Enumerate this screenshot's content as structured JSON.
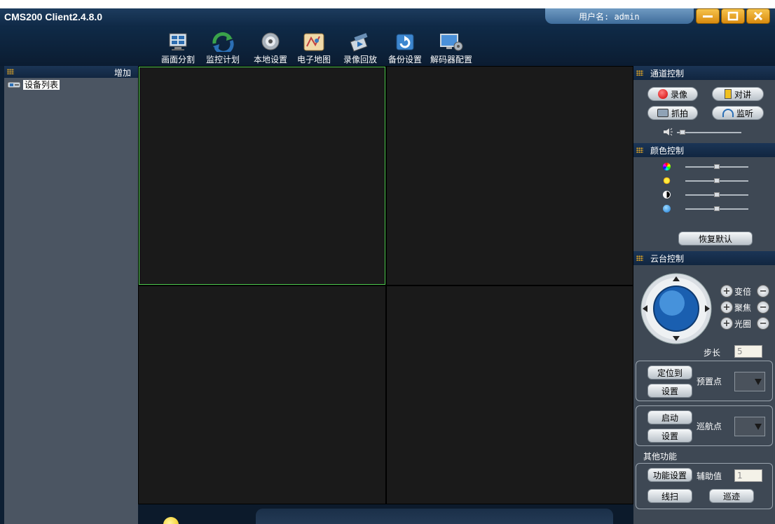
{
  "window": {
    "title": "CMS200 Client2.4.8.0",
    "user_label": "用户名: admin"
  },
  "toolbar": {
    "items": [
      {
        "label": "画面分割",
        "icon": "screen-split-icon"
      },
      {
        "label": "监控计划",
        "icon": "monitor-plan-icon"
      },
      {
        "label": "本地设置",
        "icon": "local-settings-gear-icon"
      },
      {
        "label": "电子地图",
        "icon": "e-map-icon"
      },
      {
        "label": "录像回放",
        "icon": "playback-icon"
      },
      {
        "label": "备份设置",
        "icon": "backup-icon"
      },
      {
        "label": "解码器配置",
        "icon": "decoder-config-icon"
      }
    ]
  },
  "left_panel": {
    "add_label": "增加",
    "device_list_label": "设备列表"
  },
  "channel_control": {
    "title": "通道控制",
    "record": "录像",
    "talk": "对讲",
    "snapshot": "抓拍",
    "listen": "监听",
    "volume_level": 0.05
  },
  "color_control": {
    "title": "颜色控制",
    "sliders": [
      {
        "name": "hue",
        "level": 0.5
      },
      {
        "name": "brightness",
        "level": 0.5
      },
      {
        "name": "contrast",
        "level": 0.5
      },
      {
        "name": "saturation",
        "level": 0.5
      }
    ],
    "reset": "恢复默认"
  },
  "ptz_control": {
    "title": "云台控制",
    "zoom": "变倍",
    "focus": "聚焦",
    "iris": "光圈",
    "step_label": "步长",
    "step_value": "5",
    "goto": "定位到",
    "set": "设置",
    "preset_label": "预置点",
    "start": "启动",
    "set2": "设置",
    "cruise_label": "巡航点"
  },
  "other_functions": {
    "title": "其他功能",
    "func_settings": "功能设置",
    "aux_label": "辅助值",
    "aux_value": "1",
    "line_scan": "线扫",
    "track": "巡迹"
  },
  "colors": {
    "accent_green": "#4ec94e",
    "window_dark": "#0d1f33",
    "button_orange": "#f0a823"
  }
}
